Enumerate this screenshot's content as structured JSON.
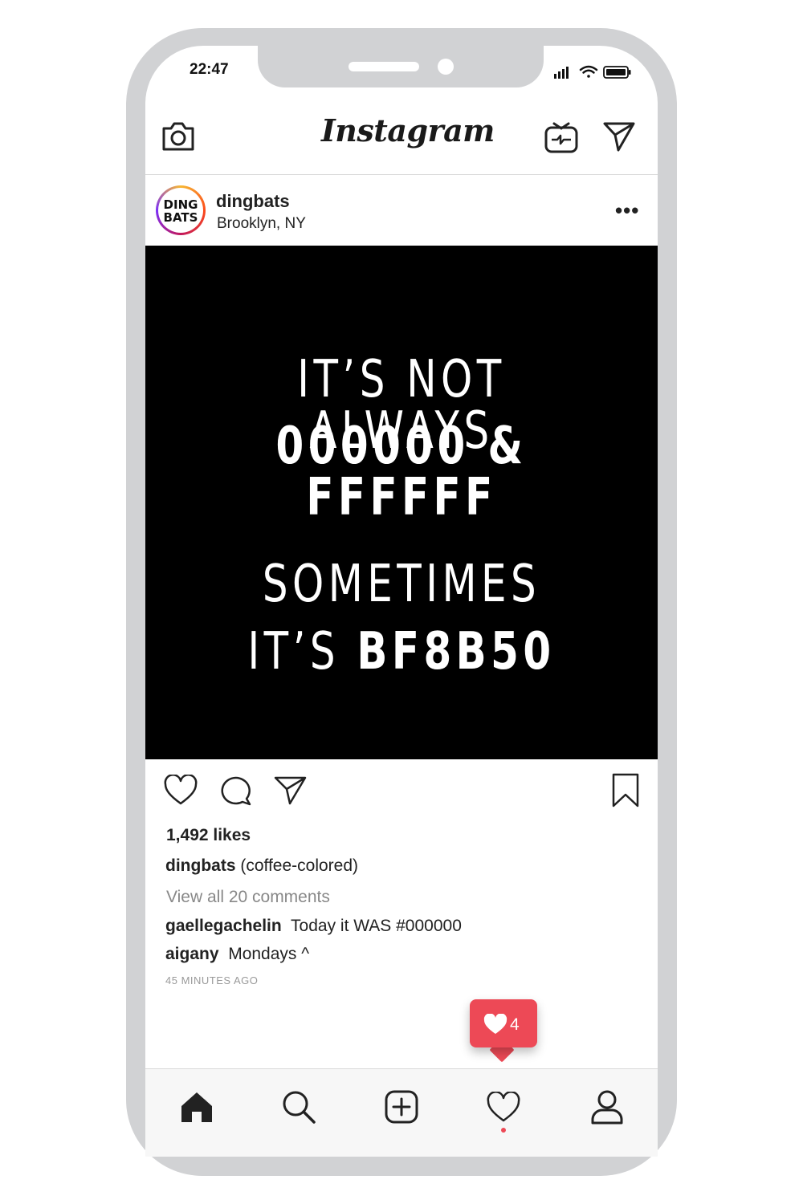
{
  "status_bar": {
    "time": "22:47"
  },
  "header": {
    "brand": "Instagram",
    "camera_icon": "camera-icon",
    "igtv_icon": "igtv-icon",
    "direct_icon": "paper-plane-icon"
  },
  "post": {
    "username": "dingbats",
    "location": "Brooklyn, NY",
    "avatar_text": "DING BATS",
    "more_label": "•••",
    "image_lines": {
      "line1": "IT’S NOT ALWAYS",
      "line2": "000000 & FFFFFF",
      "line3": "SOMETIMES",
      "line4_prefix": "IT’S ",
      "line4_bold": "BF8B50"
    },
    "likes": "1,492 likes",
    "caption_user": "dingbats",
    "caption_text": "(coffee-colored)",
    "view_all": "View all 20 comments",
    "comments": [
      {
        "user": "gaellegachelin",
        "text": "Today it WAS #000000"
      },
      {
        "user": "aigany",
        "text": "Mondays ^"
      }
    ],
    "timestamp": "45 MINUTES AGO"
  },
  "notification": {
    "count": "4",
    "icon": "heart-icon"
  },
  "tab_bar": {
    "items": [
      "home-icon",
      "search-icon",
      "add-post-icon",
      "activity-heart-icon",
      "profile-icon"
    ]
  },
  "colors": {
    "accent": "#ed4956",
    "frame": "#d1d2d4",
    "post_bg": "#000000"
  }
}
